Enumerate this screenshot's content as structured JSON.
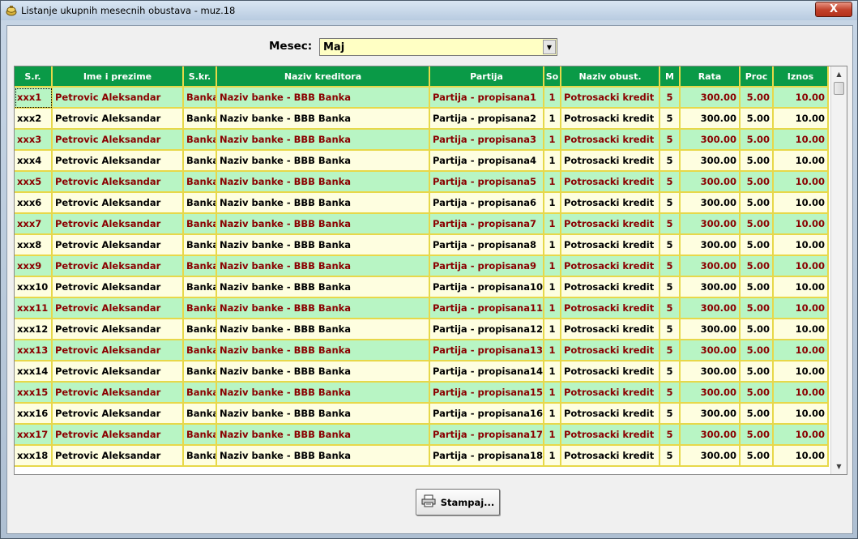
{
  "window": {
    "title": "Listanje ukupnih mesecnih obustava - muz.18",
    "close_label": "X",
    "icon": "app-icon"
  },
  "month": {
    "label": "Mesec:",
    "selected": "Maj"
  },
  "table": {
    "headers": [
      "S.r.",
      "Ime  i  prezime",
      "S.kr.",
      "Naziv kreditora",
      "Partija",
      "So",
      "Naziv obust.",
      "M",
      "Rata",
      "Proc",
      "Iznos"
    ],
    "rows": [
      [
        "xxx1",
        "Petrovic Aleksandar",
        "Banka",
        "Naziv banke - BBB Banka",
        "Partija - propisana1",
        "1",
        "Potrosacki kredit",
        "5",
        "300.00",
        "5.00",
        "10.00"
      ],
      [
        "xxx2",
        "Petrovic Aleksandar",
        "Banka",
        "Naziv banke - BBB Banka",
        "Partija - propisana2",
        "1",
        "Potrosacki kredit",
        "5",
        "300.00",
        "5.00",
        "10.00"
      ],
      [
        "xxx3",
        "Petrovic Aleksandar",
        "Banka",
        "Naziv banke - BBB Banka",
        "Partija - propisana3",
        "1",
        "Potrosacki kredit",
        "5",
        "300.00",
        "5.00",
        "10.00"
      ],
      [
        "xxx4",
        "Petrovic Aleksandar",
        "Banka",
        "Naziv banke - BBB Banka",
        "Partija - propisana4",
        "1",
        "Potrosacki kredit",
        "5",
        "300.00",
        "5.00",
        "10.00"
      ],
      [
        "xxx5",
        "Petrovic Aleksandar",
        "Banka",
        "Naziv banke - BBB Banka",
        "Partija - propisana5",
        "1",
        "Potrosacki kredit",
        "5",
        "300.00",
        "5.00",
        "10.00"
      ],
      [
        "xxx6",
        "Petrovic Aleksandar",
        "Banka",
        "Naziv banke - BBB Banka",
        "Partija - propisana6",
        "1",
        "Potrosacki kredit",
        "5",
        "300.00",
        "5.00",
        "10.00"
      ],
      [
        "xxx7",
        "Petrovic Aleksandar",
        "Banka",
        "Naziv banke - BBB Banka",
        "Partija - propisana7",
        "1",
        "Potrosacki kredit",
        "5",
        "300.00",
        "5.00",
        "10.00"
      ],
      [
        "xxx8",
        "Petrovic Aleksandar",
        "Banka",
        "Naziv banke - BBB Banka",
        "Partija - propisana8",
        "1",
        "Potrosacki kredit",
        "5",
        "300.00",
        "5.00",
        "10.00"
      ],
      [
        "xxx9",
        "Petrovic Aleksandar",
        "Banka",
        "Naziv banke - BBB Banka",
        "Partija - propisana9",
        "1",
        "Potrosacki kredit",
        "5",
        "300.00",
        "5.00",
        "10.00"
      ],
      [
        "xxx10",
        "Petrovic Aleksandar",
        "Banka",
        "Naziv banke - BBB Banka",
        "Partija - propisana10",
        "1",
        "Potrosacki kredit",
        "5",
        "300.00",
        "5.00",
        "10.00"
      ],
      [
        "xxx11",
        "Petrovic Aleksandar",
        "Banka",
        "Naziv banke - BBB Banka",
        "Partija - propisana11",
        "1",
        "Potrosacki kredit",
        "5",
        "300.00",
        "5.00",
        "10.00"
      ],
      [
        "xxx12",
        "Petrovic Aleksandar",
        "Banka",
        "Naziv banke - BBB Banka",
        "Partija - propisana12",
        "1",
        "Potrosacki kredit",
        "5",
        "300.00",
        "5.00",
        "10.00"
      ],
      [
        "xxx13",
        "Petrovic Aleksandar",
        "Banka",
        "Naziv banke - BBB Banka",
        "Partija - propisana13",
        "1",
        "Potrosacki kredit",
        "5",
        "300.00",
        "5.00",
        "10.00"
      ],
      [
        "xxx14",
        "Petrovic Aleksandar",
        "Banka",
        "Naziv banke - BBB Banka",
        "Partija - propisana14",
        "1",
        "Potrosacki kredit",
        "5",
        "300.00",
        "5.00",
        "10.00"
      ],
      [
        "xxx15",
        "Petrovic Aleksandar",
        "Banka",
        "Naziv banke - BBB Banka",
        "Partija - propisana15",
        "1",
        "Potrosacki kredit",
        "5",
        "300.00",
        "5.00",
        "10.00"
      ],
      [
        "xxx16",
        "Petrovic Aleksandar",
        "Banka",
        "Naziv banke - BBB Banka",
        "Partija - propisana16",
        "1",
        "Potrosacki kredit",
        "5",
        "300.00",
        "5.00",
        "10.00"
      ],
      [
        "xxx17",
        "Petrovic Aleksandar",
        "Banka",
        "Naziv banke - BBB Banka",
        "Partija - propisana17",
        "1",
        "Potrosacki kredit",
        "5",
        "300.00",
        "5.00",
        "10.00"
      ],
      [
        "xxx18",
        "Petrovic Aleksandar",
        "Banka",
        "Naziv banke - BBB Banka",
        "Partija - propisana18",
        "1",
        "Potrosacki kredit",
        "5",
        "300.00",
        "5.00",
        "10.00"
      ]
    ]
  },
  "print_button": {
    "label": "Stampaj...",
    "icon": "printer-icon"
  }
}
